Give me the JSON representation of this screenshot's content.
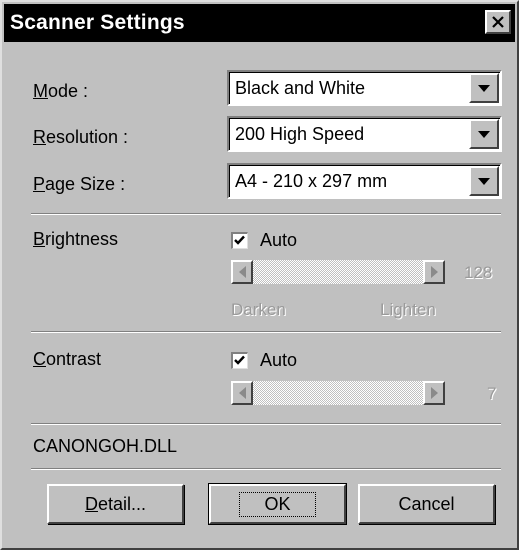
{
  "window": {
    "title": "Scanner Settings",
    "close_icon": "close-icon"
  },
  "settings": {
    "mode": {
      "label_key": "M",
      "label_rest": "ode :",
      "value": "Black and White"
    },
    "resolution": {
      "label_key": "R",
      "label_rest": "esolution :",
      "value": "200 High Speed"
    },
    "page_size": {
      "label_key": "P",
      "label_rest": "age Size :",
      "value": "A4 - 210 x 297 mm"
    }
  },
  "brightness": {
    "label_key": "B",
    "label_rest": "rightness",
    "auto_label": "Auto",
    "auto_checked": true,
    "value": "128",
    "value_fraction": 0.5,
    "left_label": "Darken",
    "right_label": "Lighten"
  },
  "contrast": {
    "label_key": "C",
    "label_rest": "ontrast",
    "auto_label": "Auto",
    "auto_checked": true,
    "value": "7"
  },
  "driver": "CANONGOH.DLL",
  "buttons": {
    "detail_key": "D",
    "detail_rest": "etail...",
    "ok": "OK",
    "cancel": "Cancel"
  }
}
